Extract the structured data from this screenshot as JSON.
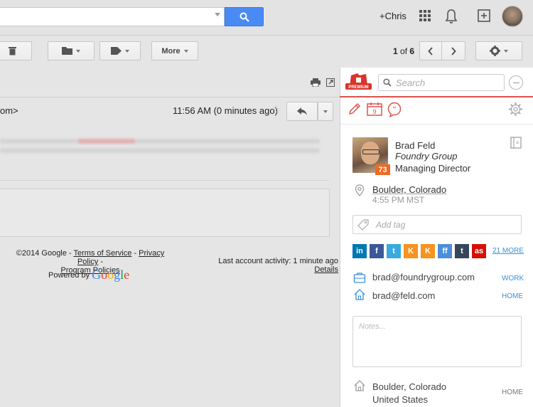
{
  "topbar": {
    "user_link": "+Chris"
  },
  "toolbar": {
    "more_label": "More",
    "pager": {
      "start": "1",
      "of": " of ",
      "total": "6"
    }
  },
  "email": {
    "sender_fragment": "om>",
    "time": "11:56 AM (0 minutes ago)"
  },
  "footer": {
    "copyright": "©2014 Google",
    "sep": " - ",
    "terms": "Terms of Service",
    "privacy": "Privacy Policy",
    "program": "Program Policies",
    "powered_by": "Powered by",
    "google": "Google",
    "last_activity": "Last account activity: 1 minute ago",
    "details": "Details"
  },
  "sidebar": {
    "search_placeholder": "Search",
    "logo_badge": "PREMIUM",
    "calendar_day": "9",
    "contact": {
      "name": "Brad Feld",
      "company": "Foundry Group",
      "title": "Managing Director",
      "score": "73",
      "location": "Boulder, Colorado",
      "local_time": "4:55 PM MST"
    },
    "tag_placeholder": "Add tag",
    "social": [
      {
        "label": "in",
        "color": "#0077b5"
      },
      {
        "label": "f",
        "color": "#3b5998"
      },
      {
        "label": "t",
        "color": "#3aa9e0"
      },
      {
        "label": "K",
        "color": "#f7931e"
      },
      {
        "label": "K",
        "color": "#f7931e"
      },
      {
        "label": "ff",
        "color": "#4c8ed9"
      },
      {
        "label": "t",
        "color": "#36465d"
      },
      {
        "label": "as",
        "color": "#d51007"
      }
    ],
    "more_social": "21 MORE",
    "emails": [
      {
        "address": "brad@foundrygroup.com",
        "label": "WORK"
      },
      {
        "address": "brad@feld.com",
        "label": "HOME"
      }
    ],
    "notes_placeholder": "Notes...",
    "address": {
      "city": "Boulder, Colorado",
      "country": "United States",
      "label": "HOME"
    }
  }
}
